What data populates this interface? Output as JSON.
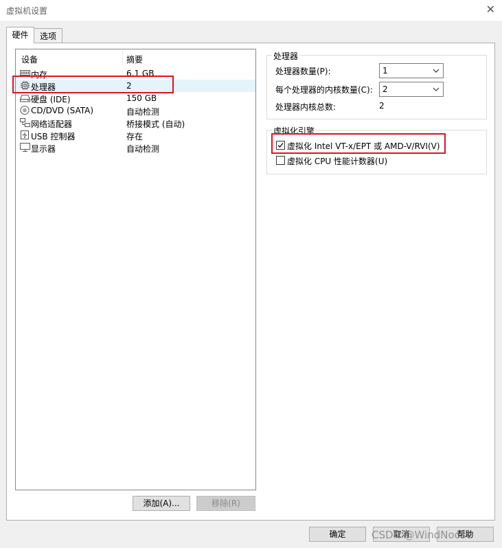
{
  "window": {
    "title": "虚拟机设置"
  },
  "tabs": [
    {
      "label": "硬件"
    },
    {
      "label": "选项"
    }
  ],
  "device_list": {
    "columns": {
      "device": "设备",
      "summary": "摘要"
    },
    "rows": [
      {
        "icon": "memory-icon",
        "name": "内存",
        "summary": "6.1 GB"
      },
      {
        "icon": "processor-icon",
        "name": "处理器",
        "summary": "2"
      },
      {
        "icon": "hard-disk-icon",
        "name": "硬盘 (IDE)",
        "summary": "150 GB"
      },
      {
        "icon": "cd-dvd-icon",
        "name": "CD/DVD (SATA)",
        "summary": "自动检测"
      },
      {
        "icon": "network-adapter-icon",
        "name": "网络适配器",
        "summary": "桥接模式 (自动)"
      },
      {
        "icon": "usb-controller-icon",
        "name": "USB 控制器",
        "summary": "存在"
      },
      {
        "icon": "display-icon",
        "name": "显示器",
        "summary": "自动检测"
      }
    ]
  },
  "buttons": {
    "add": "添加(A)...",
    "remove": "移除(R)",
    "ok": "确定",
    "cancel": "取消",
    "help": "帮助"
  },
  "processor_group": {
    "title": "处理器",
    "num_processors_label": "处理器数量(P):",
    "num_processors_value": "1",
    "cores_label": "每个处理器的内核数量(C):",
    "cores_value": "2",
    "total_label": "处理器内核总数:",
    "total_value": "2"
  },
  "virtualization_group": {
    "title": "虚拟化引擎",
    "vtx_label": "虚拟化 Intel VT-x/EPT 或 AMD-V/RVI(V)",
    "vtx_checked": true,
    "cpu_counter_label": "虚拟化 CPU 性能计数器(U)",
    "cpu_counter_checked": false
  },
  "watermark": "CSDN @WindNoose",
  "colors": {
    "highlight_red": "#e0121d",
    "selection": "#e5f3fb"
  }
}
